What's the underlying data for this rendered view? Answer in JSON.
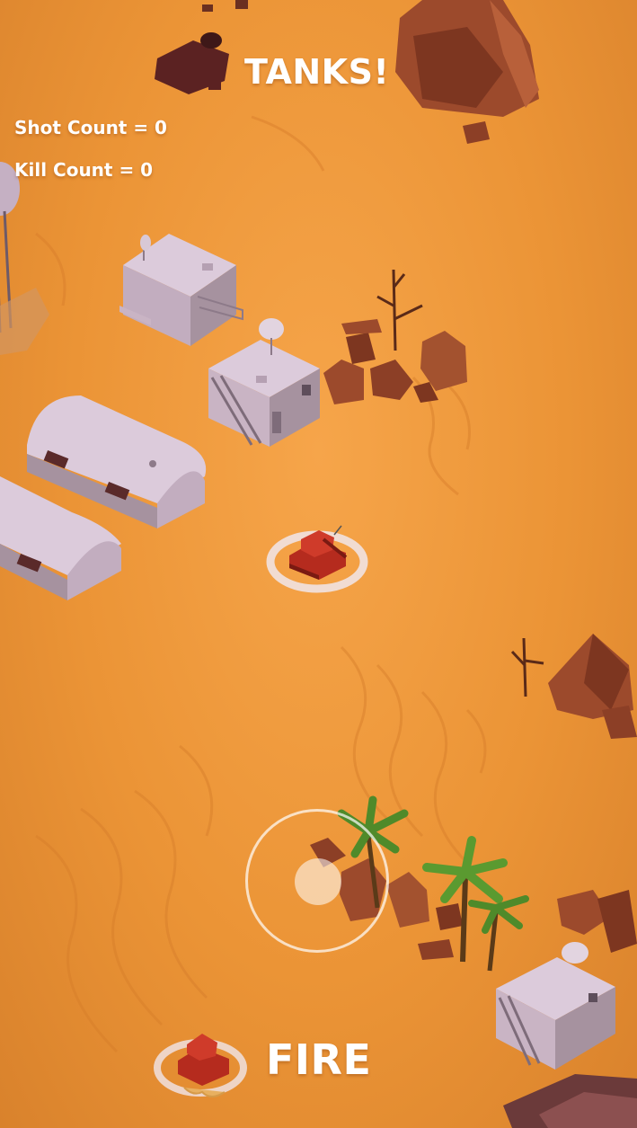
{
  "hud": {
    "title": "TANKS!",
    "shot_count": "Shot Count = 0",
    "kill_count": "Kill Count = 0",
    "fire_label": "FIRE"
  },
  "colors": {
    "sand": "#eb9436",
    "building": "#c9b4c4",
    "rock": "#8c3f26",
    "player_tank": "#b52b1e",
    "palm": "#4f8a2a"
  }
}
